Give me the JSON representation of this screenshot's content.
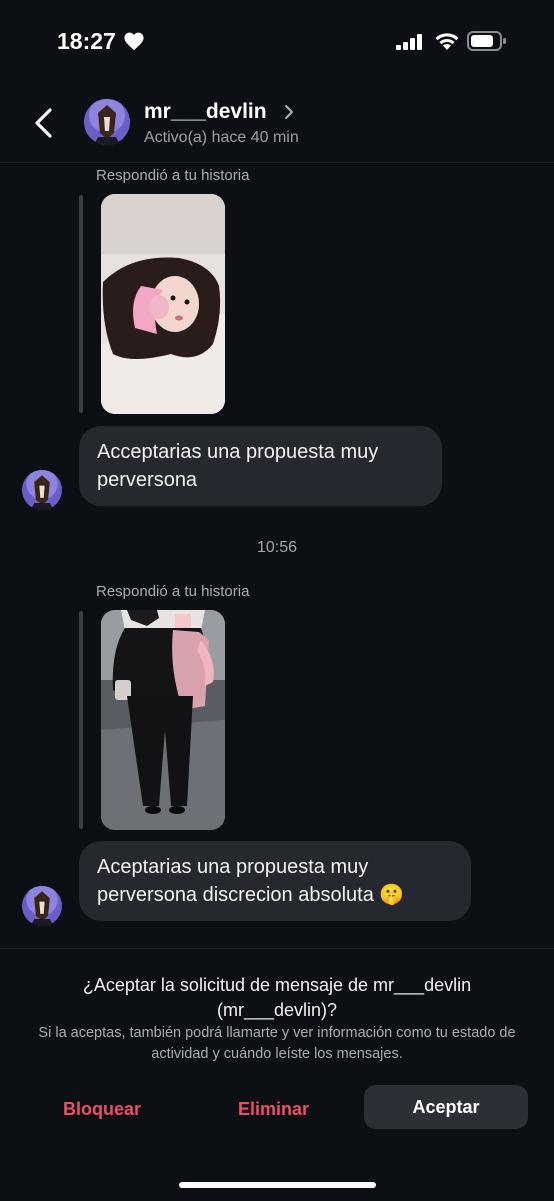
{
  "status_bar": {
    "time": "18:27"
  },
  "header": {
    "username": "mr___devlin",
    "activity": "Activo(a) hace 40 min"
  },
  "messages": [
    {
      "replied_label": "Respondió a tu historia",
      "text": "Acceptarias una propuesta muy perversona"
    },
    {
      "replied_label": "Respondió a tu historia",
      "text": "Aceptarias una propuesta muy perversona discrecion absoluta 🤫"
    }
  ],
  "timestamp": "10:56",
  "request": {
    "title": "¿Aceptar la solicitud de mensaje de mr___devlin (mr___devlin)?",
    "subtitle": "Si la aceptas, también podrá llamarte y ver información como tu estado de actividad y cuándo leíste los mensajes.",
    "block_label": "Bloquear",
    "delete_label": "Eliminar",
    "accept_label": "Aceptar"
  },
  "colors": {
    "background": "#0c0f14",
    "bubble": "#25292f",
    "danger": "#ed4e66",
    "accept_button": "#2b2f36"
  }
}
